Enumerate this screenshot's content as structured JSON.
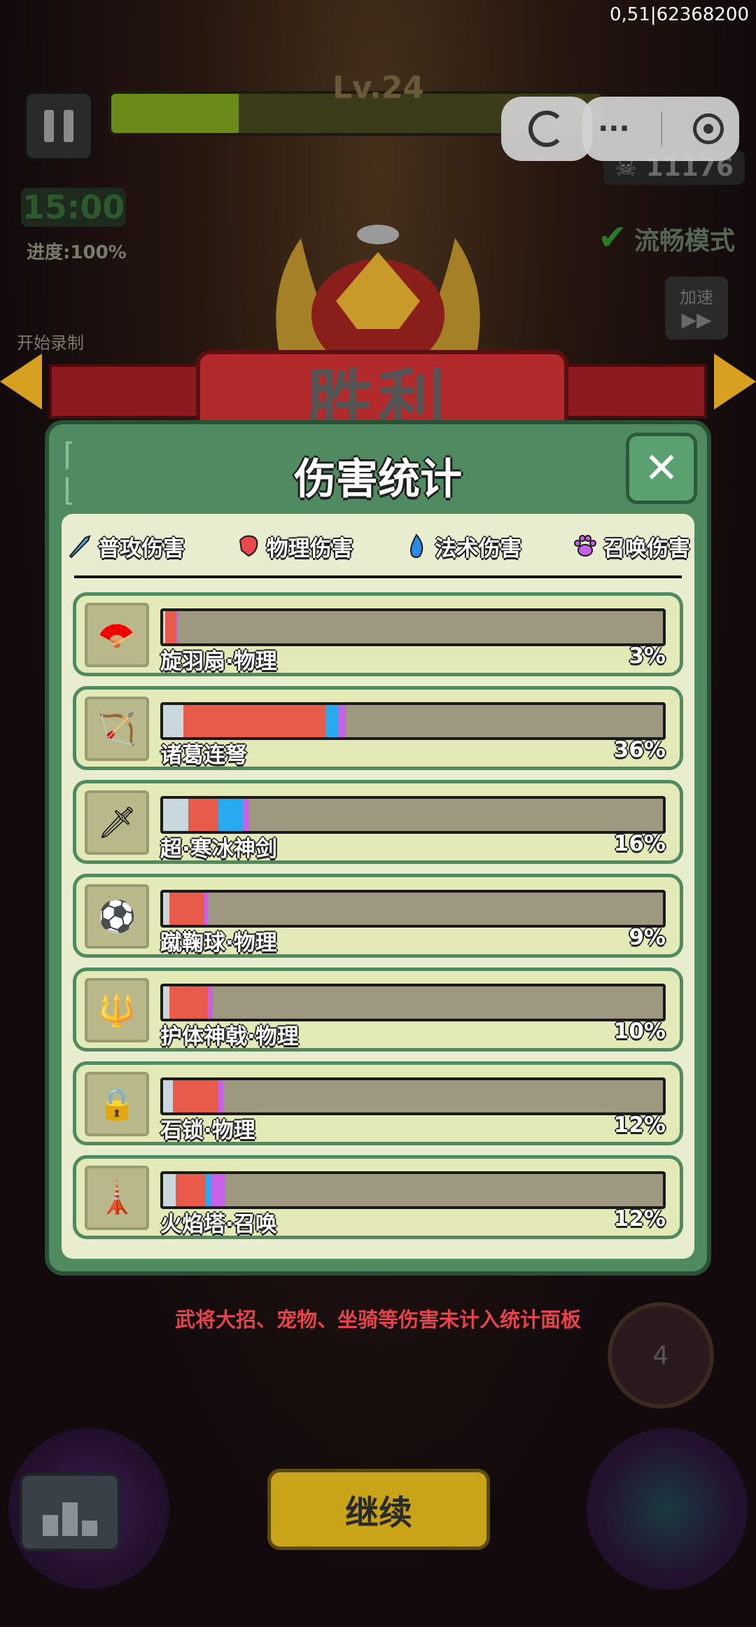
{
  "hud": {
    "device_id": "0,51|62368200",
    "level": "Lv.24",
    "xp_fraction": 0.26,
    "kills": "11176",
    "timer": "15:00",
    "progress": "进度:100%",
    "smooth_mode": "流畅模式",
    "speed_label": "加速",
    "speed_icon": "▶▶",
    "record_label": "开始录制",
    "skill_count": "4",
    "menu_dots": "···"
  },
  "victory": {
    "title": "胜利"
  },
  "dialog": {
    "title": "伤害统计",
    "close_icon": "✕",
    "legend": [
      {
        "label": "普攻伤害",
        "icon": "sword-icon",
        "color": "#4aa8e8"
      },
      {
        "label": "物理伤害",
        "icon": "fist-icon",
        "color": "#e84848"
      },
      {
        "label": "法术伤害",
        "icon": "flame-icon",
        "color": "#2a8ae8"
      },
      {
        "label": "召唤伤害",
        "icon": "paw-icon",
        "color": "#c860e8"
      }
    ],
    "rows": [
      {
        "name": "旋羽扇·物理",
        "percent": "3%",
        "icon": "fan-icon",
        "glyph": "🪭",
        "segments": [
          {
            "color": "#c8d8dc",
            "value": 0.004
          },
          {
            "color": "#e85a4a",
            "value": 0.022
          },
          {
            "color": "#c860e8",
            "value": 0.004
          }
        ]
      },
      {
        "name": "诸葛连弩",
        "percent": "36%",
        "icon": "crossbow-icon",
        "glyph": "🏹",
        "segments": [
          {
            "color": "#c8d8dc",
            "value": 0.04
          },
          {
            "color": "#e85a4a",
            "value": 0.285
          },
          {
            "color": "#28aaf0",
            "value": 0.025
          },
          {
            "color": "#c860e8",
            "value": 0.015
          }
        ]
      },
      {
        "name": "超·寒冰神剑",
        "percent": "16%",
        "icon": "ice-sword-icon",
        "glyph": "🗡",
        "segments": [
          {
            "color": "#c8d8dc",
            "value": 0.05
          },
          {
            "color": "#e85a4a",
            "value": 0.06
          },
          {
            "color": "#28aaf0",
            "value": 0.05
          },
          {
            "color": "#c860e8",
            "value": 0.012
          }
        ]
      },
      {
        "name": "蹴鞠球·物理",
        "percent": "9%",
        "icon": "ball-icon",
        "glyph": "⚽",
        "segments": [
          {
            "color": "#c8d8dc",
            "value": 0.012
          },
          {
            "color": "#e85a4a",
            "value": 0.07
          },
          {
            "color": "#c860e8",
            "value": 0.008
          }
        ]
      },
      {
        "name": "护体神戟·物理",
        "percent": "10%",
        "icon": "halberd-icon",
        "glyph": "🔱",
        "segments": [
          {
            "color": "#c8d8dc",
            "value": 0.012
          },
          {
            "color": "#e85a4a",
            "value": 0.078
          },
          {
            "color": "#c860e8",
            "value": 0.01
          }
        ]
      },
      {
        "name": "石锁·物理",
        "percent": "12%",
        "icon": "stone-lock-icon",
        "glyph": "🔒",
        "segments": [
          {
            "color": "#c8d8dc",
            "value": 0.02
          },
          {
            "color": "#e85a4a",
            "value": 0.09
          },
          {
            "color": "#c860e8",
            "value": 0.01
          }
        ]
      },
      {
        "name": "火焰塔·召唤",
        "percent": "12%",
        "icon": "fire-tower-icon",
        "glyph": "🗼",
        "segments": [
          {
            "color": "#c8d8dc",
            "value": 0.025
          },
          {
            "color": "#e85a4a",
            "value": 0.06
          },
          {
            "color": "#28aaf0",
            "value": 0.012
          },
          {
            "color": "#c860e8",
            "value": 0.028
          }
        ]
      }
    ]
  },
  "note": "武将大招、宠物、坐骑等伤害未计入统计面板",
  "continue_label": "继续"
}
